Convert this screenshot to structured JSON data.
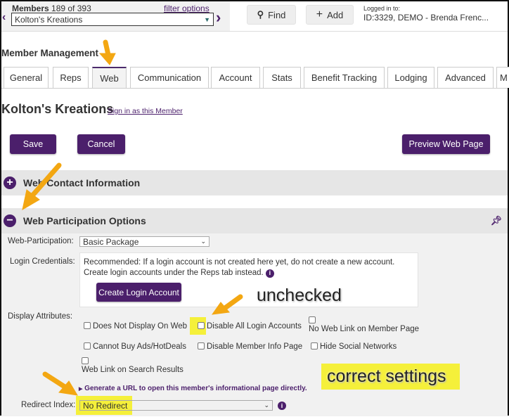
{
  "header": {
    "members_label": "Members",
    "members_count": "189 of 393",
    "filter_options": "filter options",
    "member_select": "Kolton's Kreations",
    "find": "Find",
    "add": "Add",
    "logged_in_label": "Logged in to:",
    "logged_in_value": "ID:3329, DEMO - Brenda Frenc..."
  },
  "page_title": "Member Management",
  "tabs": [
    "General",
    "Reps",
    "Web",
    "Communication",
    "Account",
    "Stats",
    "Benefit Tracking",
    "Lodging",
    "Advanced",
    "M"
  ],
  "member": {
    "name": "Kolton's Kreations",
    "sign_in": "Sign in as this Member"
  },
  "buttons": {
    "save": "Save",
    "cancel": "Cancel",
    "preview": "Preview Web Page"
  },
  "sections": {
    "contact": "Web Contact Information",
    "participation": "Web Participation Options"
  },
  "form": {
    "web_participation_label": "Web-Participation:",
    "web_participation_value": "Basic Package",
    "login_credentials_label": "Login Credentials:",
    "login_note": "Recommended: If a login account is not created here yet, do not create a new account. Create login accounts under the Reps tab instead.",
    "create_login": "Create Login Account",
    "display_attributes_label": "Display Attributes:",
    "attributes": [
      "Does Not Display On Web",
      "Disable All Login Accounts",
      "No Web Link on Member Page",
      "Cannot Buy Ads/HotDeals",
      "Disable Member Info Page",
      "Hide Social Networks",
      "Web Link on Search Results"
    ],
    "generate_url": "Generate a URL to open this member's informational page directly.",
    "redirect_label": "Redirect Index:",
    "redirect_value": "No Redirect"
  },
  "annotations": {
    "unchecked": "unchecked",
    "correct": "correct settings"
  },
  "colors": {
    "accent": "#4b1f6b",
    "highlight": "#f5f03a",
    "arrow": "#f3a712"
  }
}
